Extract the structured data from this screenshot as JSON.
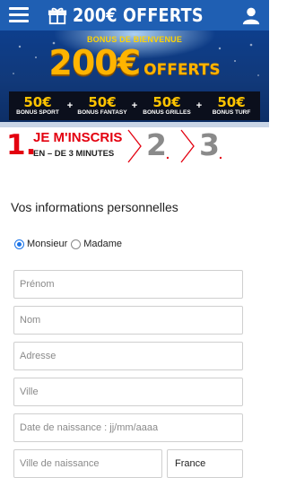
{
  "header": {
    "title": "200€ OFFERTS",
    "menu_icon": "hamburger-menu-icon",
    "gift_icon": "gift-icon",
    "user_icon": "user-icon",
    "color": "#1f5fb3"
  },
  "banner": {
    "subtitle": "BONUS DE BIENVENUE",
    "amount": "200€",
    "amount_suffix": "OFFERTS",
    "bonuses": [
      {
        "value": "50€",
        "label": "BONUS SPORT"
      },
      {
        "value": "50€",
        "label": "BONUS FANTASY"
      },
      {
        "value": "50€",
        "label": "BONUS GRILLES"
      },
      {
        "value": "50€",
        "label": "BONUS TURF"
      }
    ],
    "plus": "+",
    "accent": "#ffb400"
  },
  "steps": {
    "step1_number": "1.",
    "step1_title": "JE M'INSCRIS",
    "step1_subtitle": "EN – DE 3 MINUTES",
    "step2_number": "2",
    "step3_number": "3",
    "dot": ".",
    "active_color": "#e3000f"
  },
  "form": {
    "section_title": "Vos informations personnelles",
    "civility": {
      "options": [
        "Monsieur",
        "Madame"
      ],
      "selected": "Monsieur"
    },
    "fields": {
      "prenom": "Prénom",
      "nom": "Nom",
      "adresse": "Adresse",
      "ville": "Ville",
      "date_naissance": "Date de naissance : jj/mm/aaaa",
      "ville_naissance": "Ville de naissance"
    },
    "country_select": "France"
  }
}
